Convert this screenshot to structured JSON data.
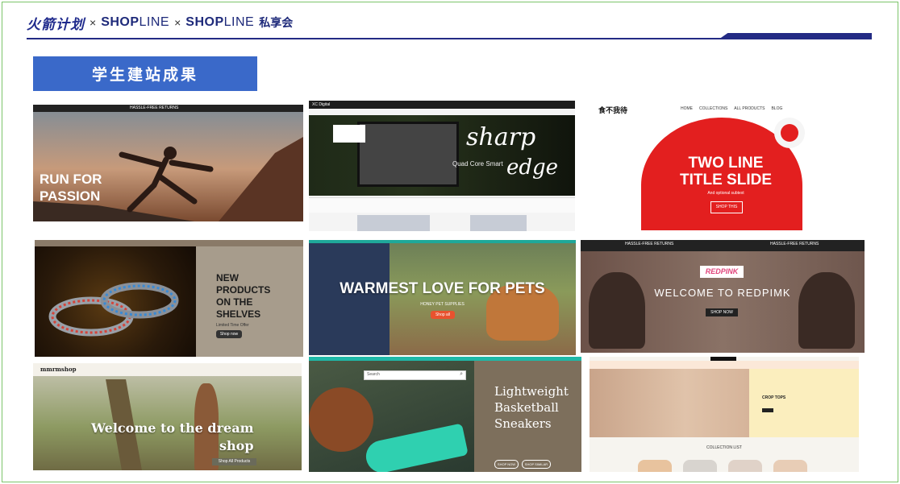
{
  "header": {
    "brand_cn": "火箭计划",
    "separator": "×",
    "shopline_bold": "SHOP",
    "shopline_light": "LINE",
    "private_club": "私享会"
  },
  "title": "学生建站成果",
  "thumbnails": {
    "t1": {
      "banner": "HASSLE-FREE RETURNS",
      "headline_line1": "RUN FOR",
      "headline_line2": "PASSION"
    },
    "t2": {
      "logo": "XC Digital",
      "headline1": "sharp",
      "headline2": "edge",
      "subtitle": "Quad Core Smart"
    },
    "t3": {
      "logo": "食不我待",
      "nav": [
        "HOME",
        "COLLECTIONS",
        "ALL PRODUCTS",
        "BLOG"
      ],
      "headline_line1": "TWO LINE",
      "headline_line2": "TITLE SLIDE",
      "subtitle": "And optional subtext",
      "button": "SHOP THIS"
    },
    "t4": {
      "headline_line1": "NEW",
      "headline_line2": "PRODUCTS",
      "headline_line3": "ON THE",
      "headline_line4": "SHELVES",
      "subtitle": "Limited Time Offer",
      "button": "Shop now"
    },
    "t5": {
      "headline": "WARMEST LOVE FOR PETS",
      "subtitle": "HONEY PET SUPPLIES",
      "button": "Shop all"
    },
    "t6": {
      "banner_left": "HASSLE-FREE RETURNS",
      "banner_right": "HASSLE-FREE RETURNS",
      "logo": "REDPINK",
      "headline": "WELCOME TO REDPIMK",
      "button": "SHOP NOW"
    },
    "t7": {
      "logo": "mmrmshop",
      "headline_line1": "Welcome to the dream",
      "headline_line2": "shop",
      "button": "Shop All Products"
    },
    "t8": {
      "search": "Search",
      "headline_line1": "Lightweight",
      "headline_line2": "Basketball",
      "headline_line3": "Sneakers",
      "button1": "SHOP NOW",
      "button2": "SHOP SIMILAR"
    },
    "t9": {
      "headline": "CROP TOPS",
      "section": "COLLECTION LIST"
    }
  }
}
